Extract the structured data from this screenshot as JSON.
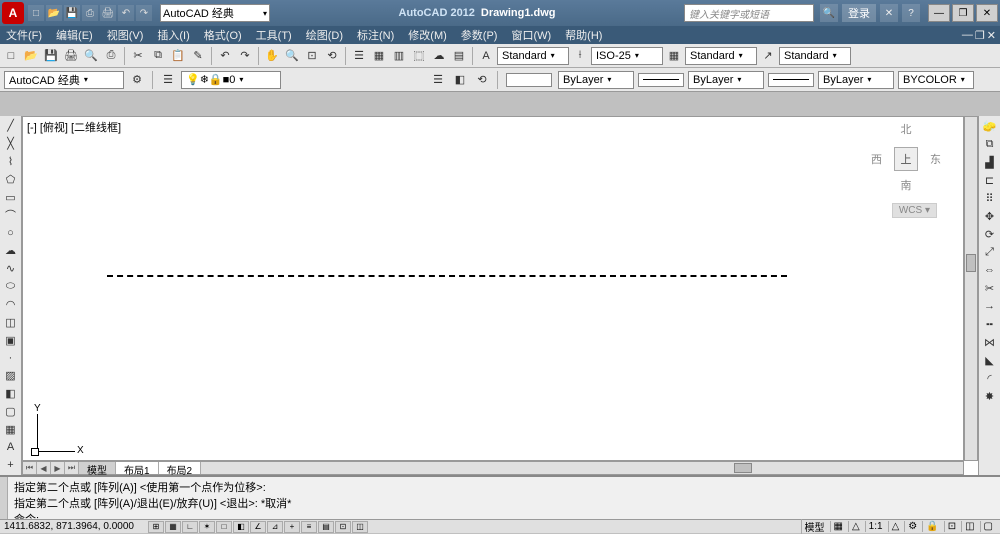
{
  "title": {
    "app": "AutoCAD 2012",
    "doc": "Drawing1.dwg"
  },
  "workspace_selector": "AutoCAD 经典",
  "search_placeholder": "键入关键字或短语",
  "login_label": "登录",
  "menubar": [
    "文件(F)",
    "编辑(E)",
    "视图(V)",
    "插入(I)",
    "格式(O)",
    "工具(T)",
    "绘图(D)",
    "标注(N)",
    "修改(M)",
    "参数(P)",
    "窗口(W)",
    "帮助(H)"
  ],
  "styles": {
    "text": "Standard",
    "dim": "ISO-25",
    "table": "Standard",
    "mleader": "Standard"
  },
  "layer_row": {
    "workspace": "AutoCAD 经典",
    "layer": "0"
  },
  "props": {
    "color": "ByLayer",
    "linetype": "ByLayer",
    "lineweight": "ByLayer",
    "plotstyle": "BYCOLOR"
  },
  "viewport_label": "[-] [俯视] [二维线框]",
  "viewcube": {
    "north": "北",
    "south": "南",
    "east": "东",
    "west": "西",
    "top": "上",
    "wcs": "WCS ▾"
  },
  "ucs": {
    "x": "X",
    "y": "Y"
  },
  "tabs": {
    "model": "模型",
    "layout1": "布局1",
    "layout2": "布局2"
  },
  "command": {
    "line1": "指定第二个点或 [阵列(A)] <使用第一个点作为位移>:",
    "line2": "指定第二个点或 [阵列(A)/退出(E)/放弃(U)] <退出>: *取消*",
    "prompt": "命令:"
  },
  "status": {
    "coords": "1411.6832, 871.3964, 0.0000",
    "model": "模型",
    "scale": "1:1",
    "ann": "△"
  }
}
